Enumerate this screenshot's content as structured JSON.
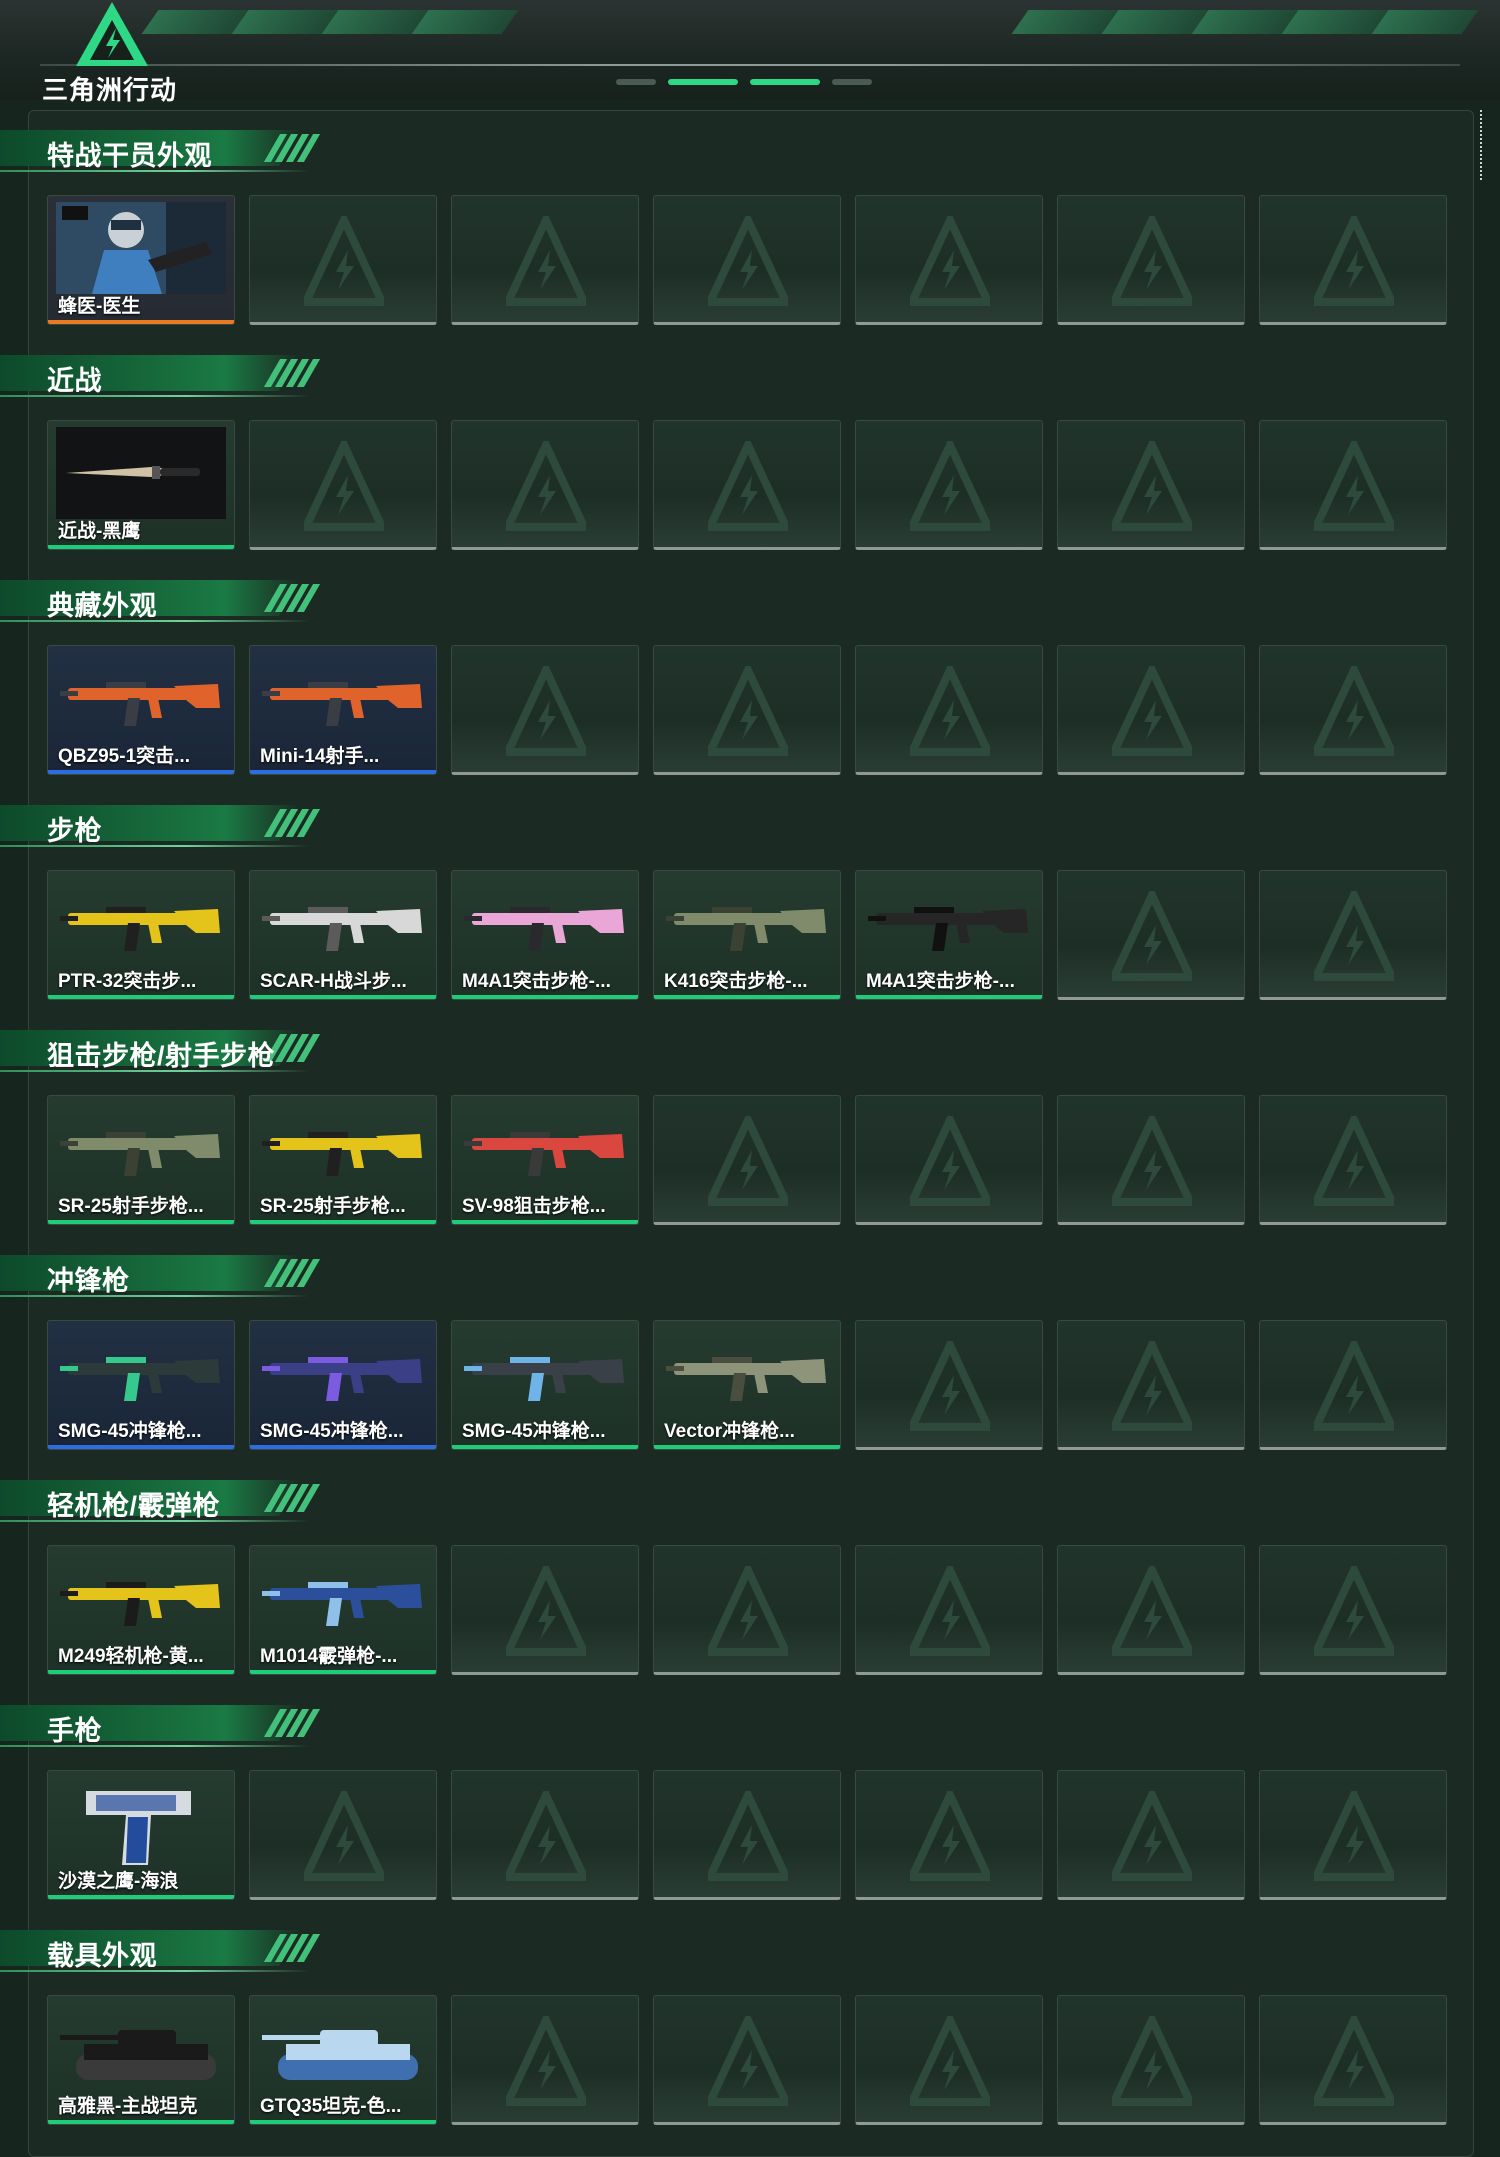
{
  "app": {
    "logo_text": "三角洲行动"
  },
  "colors": {
    "green_rarity": "#1fcc7a",
    "blue_rarity": "#2d6de0",
    "orange_rarity": "#e87a22",
    "empty_rarity": "#8f9a95",
    "accent": "#2fd885"
  },
  "sections": [
    {
      "title": "特战干员外观",
      "items": [
        {
          "label": "蜂医-医生",
          "rarity": "orange",
          "icon": "operator-portrait-icon"
        }
      ]
    },
    {
      "title": "近战",
      "items": [
        {
          "label": "近战-黑鹰",
          "rarity": "green",
          "icon": "knife-icon"
        }
      ]
    },
    {
      "title": "典藏外观",
      "items": [
        {
          "label": "QBZ95-1突击...",
          "rarity": "blue",
          "icon": "rifle-orange-icon"
        },
        {
          "label": "Mini-14射手...",
          "rarity": "blue",
          "icon": "rifle-orange-icon"
        }
      ]
    },
    {
      "title": "步枪",
      "items": [
        {
          "label": "PTR-32突击步...",
          "rarity": "green",
          "icon": "rifle-yellow-icon"
        },
        {
          "label": "SCAR-H战斗步...",
          "rarity": "green",
          "icon": "rifle-white-icon"
        },
        {
          "label": "M4A1突击步枪-...",
          "rarity": "green",
          "icon": "rifle-pink-icon"
        },
        {
          "label": "K416突击步枪-...",
          "rarity": "green",
          "icon": "rifle-camo-icon"
        },
        {
          "label": "M4A1突击步枪-...",
          "rarity": "green",
          "icon": "rifle-black-icon"
        }
      ]
    },
    {
      "title": "狙击步枪/射手步枪",
      "items": [
        {
          "label": "SR-25射手步枪...",
          "rarity": "green",
          "icon": "rifle-camo-icon"
        },
        {
          "label": "SR-25射手步枪...",
          "rarity": "green",
          "icon": "rifle-yellow-icon"
        },
        {
          "label": "SV-98狙击步枪...",
          "rarity": "green",
          "icon": "sniper-red-icon"
        }
      ]
    },
    {
      "title": "冲锋枪",
      "items": [
        {
          "label": "SMG-45冲锋枪...",
          "rarity": "blue",
          "icon": "smg-green-icon"
        },
        {
          "label": "SMG-45冲锋枪...",
          "rarity": "blue",
          "icon": "smg-purple-icon"
        },
        {
          "label": "SMG-45冲锋枪...",
          "rarity": "green",
          "icon": "smg-blue-icon"
        },
        {
          "label": "Vector冲锋枪...",
          "rarity": "green",
          "icon": "smg-camo-icon"
        }
      ]
    },
    {
      "title": "轻机枪/霰弹枪",
      "items": [
        {
          "label": "M249轻机枪-黄...",
          "rarity": "green",
          "icon": "lmg-yellow-icon"
        },
        {
          "label": "M1014霰弹枪-...",
          "rarity": "green",
          "icon": "shotgun-blue-icon"
        }
      ]
    },
    {
      "title": "手枪",
      "items": [
        {
          "label": "沙漠之鹰-海浪",
          "rarity": "green",
          "icon": "pistol-blue-icon"
        }
      ]
    },
    {
      "title": "载具外观",
      "items": [
        {
          "label": "高雅黑-主战坦克",
          "rarity": "green",
          "icon": "tank-black-icon"
        },
        {
          "label": "GTQ35坦克-色...",
          "rarity": "green",
          "icon": "tank-blue-icon"
        }
      ]
    }
  ]
}
